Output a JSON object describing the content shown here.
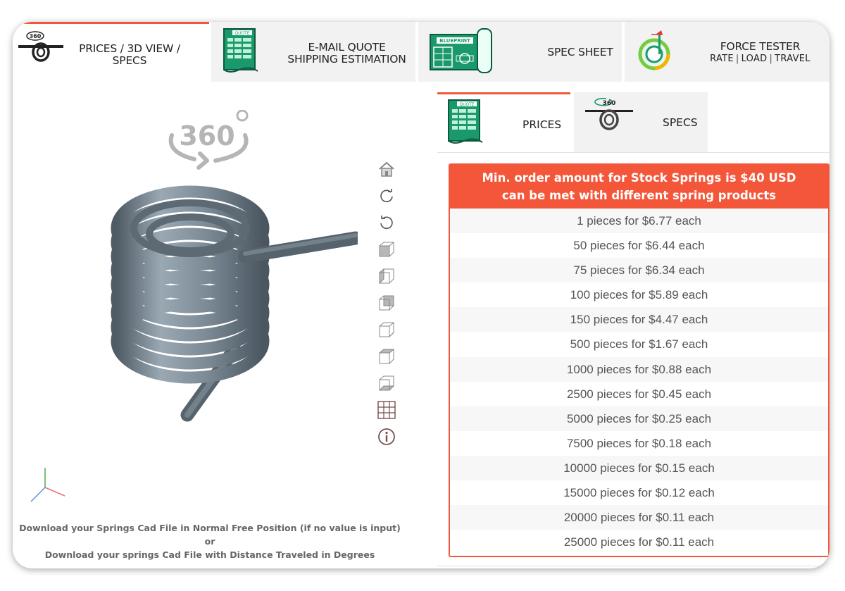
{
  "top_tabs": [
    {
      "label": "PRICES / 3D VIEW / SPECS",
      "icon": "spring-360-icon",
      "active": true
    },
    {
      "label_line1": "E-MAIL QUOTE",
      "label_line2": "SHIPPING ESTIMATION",
      "icon": "quote-sheet-icon",
      "icon_text": "QUOTE"
    },
    {
      "label": "SPEC SHEET",
      "icon": "blueprint-icon",
      "icon_text": "BLUEPRINT"
    },
    {
      "label": "FORCE TESTER",
      "sub": [
        "RATE",
        "LOAD",
        "TRAVEL"
      ],
      "sep": "|",
      "icon": "force-tester-icon"
    }
  ],
  "viewer": {
    "badge_text": "360",
    "toolbar": [
      "home-icon",
      "rotate-cw-icon",
      "rotate-ccw-icon",
      "view-front-icon",
      "view-side-icon",
      "view-top-icon",
      "view-back-icon",
      "view-bottom-icon",
      "view-iso-icon",
      "grid-icon",
      "info-icon"
    ],
    "caption_line1": "Download your Springs Cad File in Normal Free Position (if no value is input) or",
    "caption_line2": "Download your springs Cad File with Distance Traveled in Degrees"
  },
  "panel_tabs": [
    {
      "label": "PRICES",
      "icon": "quote-sheet-icon",
      "icon_text": "QUOTE",
      "active": true
    },
    {
      "label": "SPECS",
      "icon": "spring-360-icon",
      "icon_text": "360"
    }
  ],
  "prices": {
    "header_line1": "Min. order amount for Stock Springs is $40 USD",
    "header_line2": "can be met with different spring products",
    "rows": [
      "1 pieces for $6.77 each",
      "50 pieces for $6.44 each",
      "75 pieces for $6.34 each",
      "100 pieces for $5.89 each",
      "150 pieces for $4.47 each",
      "500 pieces for $1.67 each",
      "1000 pieces for $0.88 each",
      "2500 pieces for $0.45 each",
      "5000 pieces for $0.25 each",
      "7500 pieces for $0.18 each",
      "10000 pieces for $0.15 each",
      "15000 pieces for $0.12 each",
      "20000 pieces for $0.11 each",
      "25000 pieces for $0.11 each"
    ]
  },
  "colors": {
    "accent": "#f0583b",
    "header_bg": "#f4563a",
    "quote_green": "#1a9a6c",
    "spring_steel": "#7a8c9a"
  }
}
